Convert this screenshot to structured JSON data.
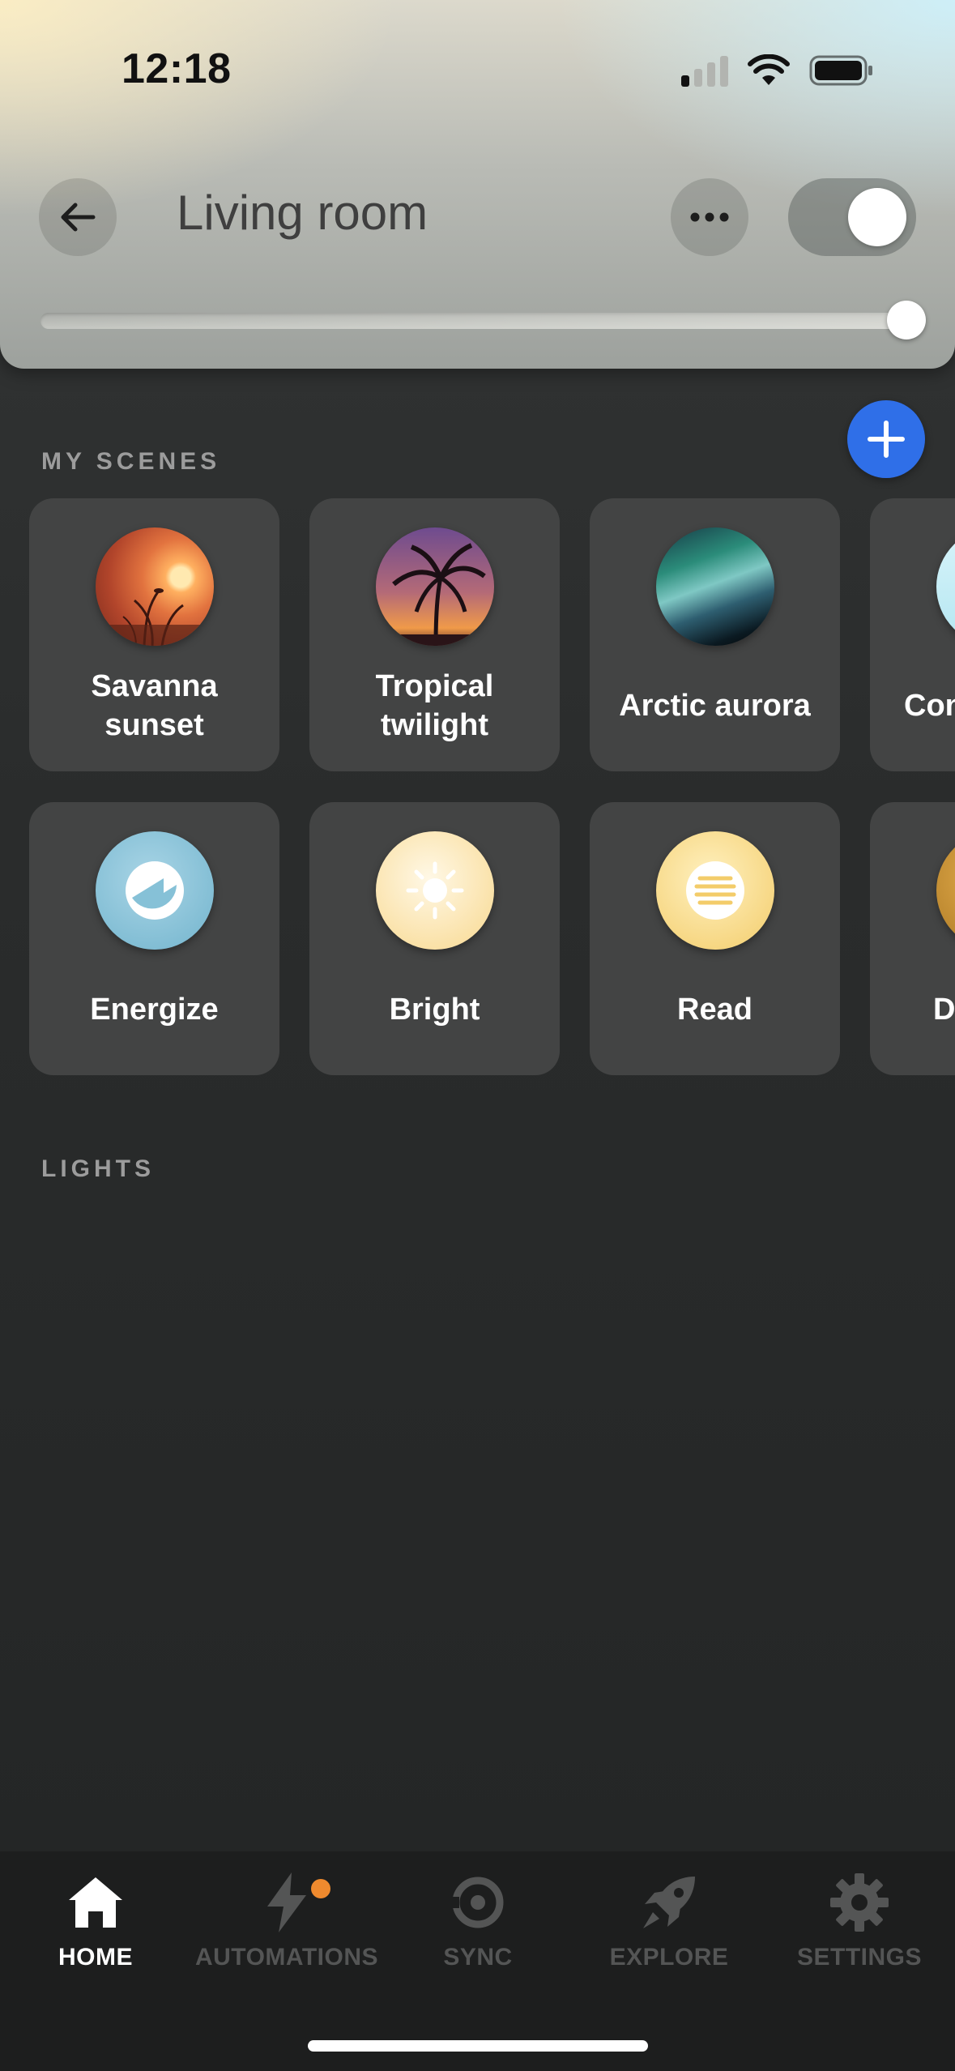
{
  "status_bar": {
    "time": "12:18"
  },
  "header": {
    "room_name": "Living room",
    "power_on": true,
    "brightness_fraction": 1.0
  },
  "sections": {
    "scenes_label": "MY SCENES",
    "lights_label": "LIGHTS"
  },
  "scenes": {
    "row1": [
      {
        "label": "Savanna\nsunset",
        "line1": "Savanna",
        "line2": "sunset",
        "icon": "savanna-sunset-photo"
      },
      {
        "label": "Tropical\ntwilight",
        "line1": "Tropical",
        "line2": "twilight",
        "icon": "tropical-twilight-photo"
      },
      {
        "label": "Arctic aurora",
        "line1": "Arctic aurora",
        "line2": "",
        "icon": "arctic-aurora-photo"
      },
      {
        "label": "Con",
        "line1": "Con",
        "line2": "",
        "icon": "concentrate-icon"
      }
    ],
    "row2": [
      {
        "label": "Energize",
        "icon": "energize-icon"
      },
      {
        "label": "Bright",
        "icon": "sun-icon"
      },
      {
        "label": "Read",
        "icon": "read-icon"
      },
      {
        "label": "D",
        "icon": "dimmed-icon"
      }
    ]
  },
  "nav": {
    "items": [
      {
        "label": "HOME",
        "icon": "home-icon",
        "active": true
      },
      {
        "label": "AUTOMATIONS",
        "icon": "bolt-icon",
        "active": false,
        "badge": true
      },
      {
        "label": "SYNC",
        "icon": "sync-icon",
        "active": false
      },
      {
        "label": "EXPLORE",
        "icon": "rocket-icon",
        "active": false
      },
      {
        "label": "SETTINGS",
        "icon": "gear-icon",
        "active": false
      }
    ]
  },
  "colors": {
    "accent_blue": "#2f6fe8",
    "badge_orange": "#ef8a2e",
    "card_bg": "#434444"
  }
}
